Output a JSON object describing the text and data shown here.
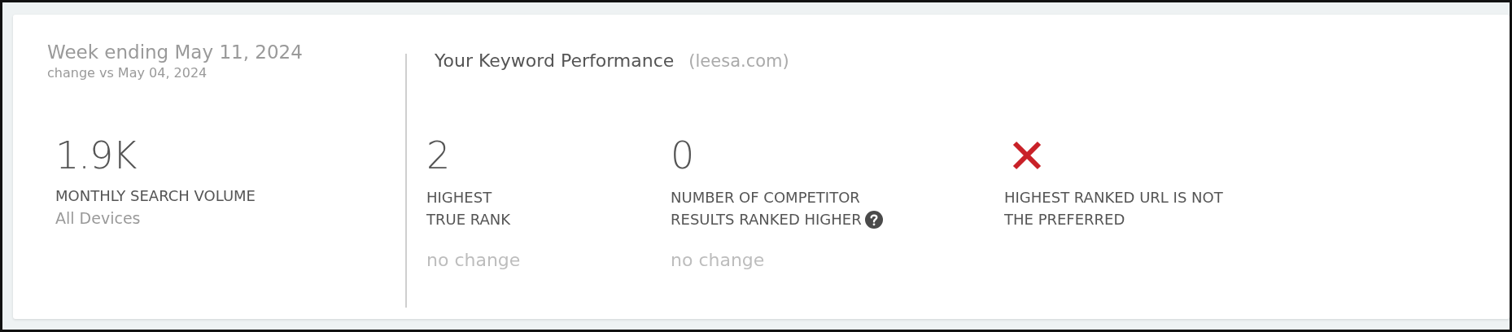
{
  "summary": {
    "week_label": "Week ending May 11, 2024",
    "comparison": "change vs May 04, 2024",
    "value": "1.9K",
    "label": "MONTHLY SEARCH VOLUME",
    "sublabel": "All Devices"
  },
  "performance": {
    "title": "Your Keyword Performance",
    "domain": "(leesa.com)",
    "metrics": [
      {
        "kind": "number",
        "value": "2",
        "label_lines": [
          "HIGHEST",
          "TRUE RANK"
        ],
        "change": "no change"
      },
      {
        "kind": "number",
        "value": "0",
        "label_lines": [
          "NUMBER OF COMPETITOR",
          "RESULTS RANKED HIGHER"
        ],
        "change": "no change",
        "help": true
      },
      {
        "kind": "status",
        "passed": false,
        "label_lines": [
          "HIGHEST RANKED URL IS NOT",
          "THE PREFERRED"
        ]
      }
    ]
  }
}
